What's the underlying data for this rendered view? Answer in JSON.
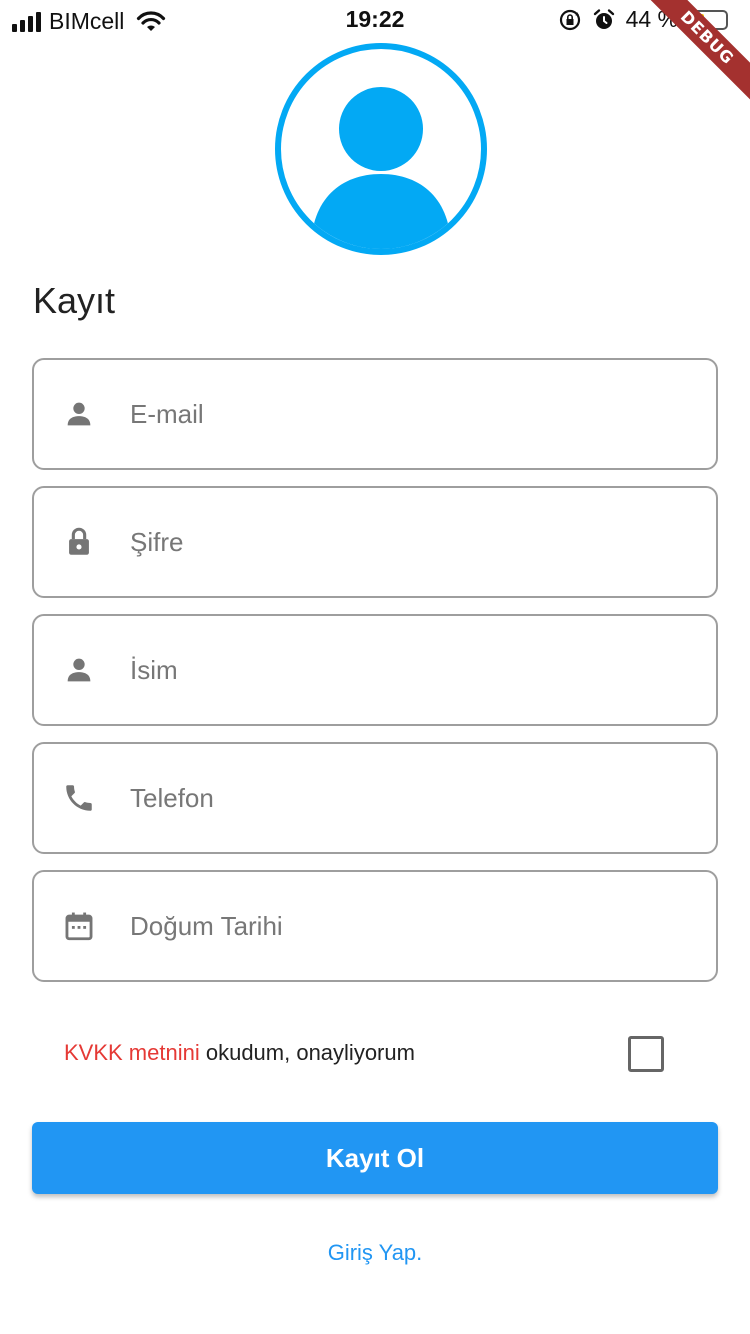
{
  "status_bar": {
    "carrier": "BIMcell",
    "time": "19:22",
    "battery_percent": "44 %",
    "battery_level": 0.44,
    "icons": [
      "signal-icon",
      "wifi-icon",
      "rotation-lock-icon",
      "alarm-icon",
      "battery-icon"
    ]
  },
  "debug_banner": {
    "label": "DEBUG"
  },
  "accent_color": "#03a9f4",
  "page": {
    "title": "Kayıt"
  },
  "form": {
    "email": {
      "placeholder": "E-mail",
      "value": "",
      "icon": "person-icon"
    },
    "password": {
      "placeholder": "Şifre",
      "value": "",
      "icon": "lock-icon"
    },
    "name": {
      "placeholder": "İsim",
      "value": "",
      "icon": "person-icon"
    },
    "phone": {
      "placeholder": "Telefon",
      "value": "",
      "icon": "phone-icon"
    },
    "birthdate": {
      "placeholder": "Doğum Tarihi",
      "value": "",
      "icon": "calendar-icon"
    }
  },
  "consent": {
    "link_text": "KVKK metnini",
    "text": " okudum, onayliyorum",
    "checked": false,
    "link_color": "#e53935"
  },
  "actions": {
    "register_label": "Kayıt Ol",
    "register_color": "#2196f3",
    "login_link": "Giriş Yap."
  }
}
